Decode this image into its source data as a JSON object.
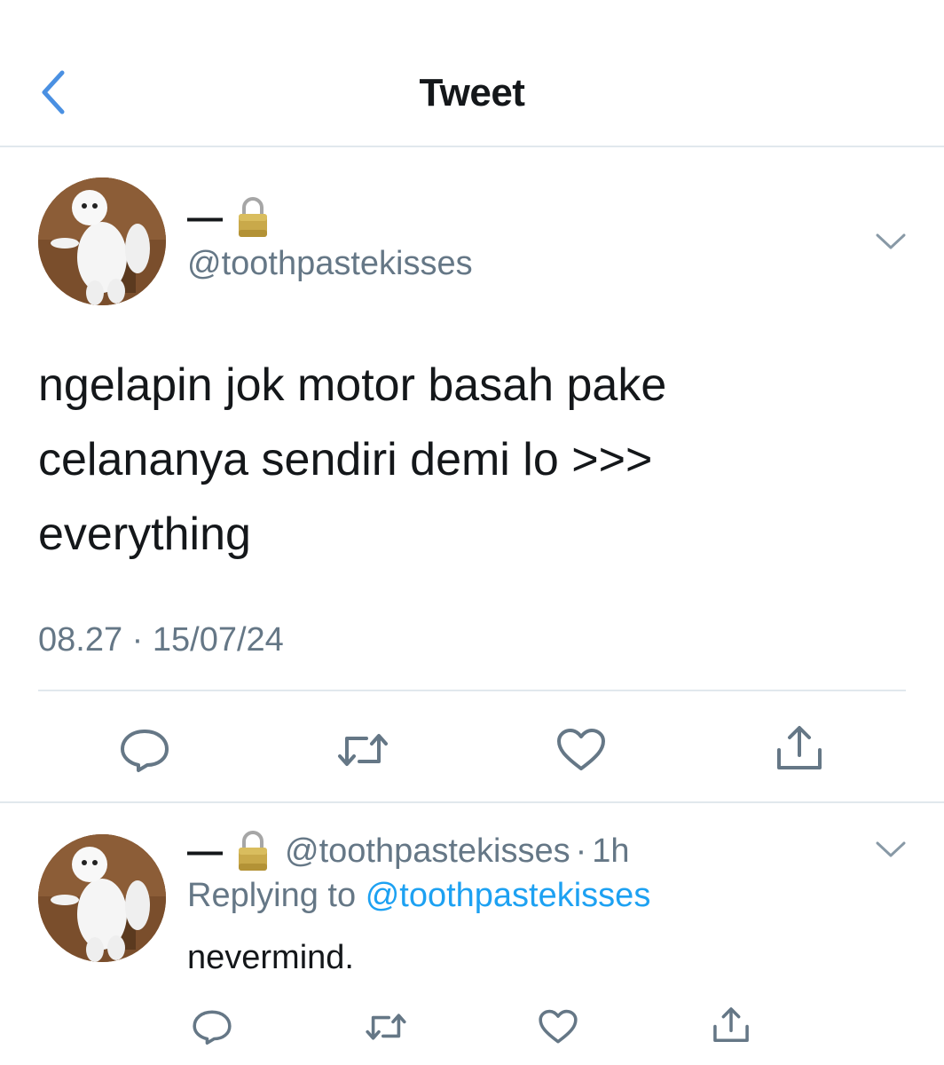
{
  "header": {
    "title": "Tweet"
  },
  "tweet": {
    "display_name": "—",
    "handle": "@toothpastekisses",
    "text_lines": [
      "ngelapin jok motor basah pake",
      "celananya sendiri demi lo >>>",
      "everything"
    ],
    "timestamp": "08.27 · 15/07/24"
  },
  "reply": {
    "display_name": "—",
    "handle": "@toothpastekisses",
    "dot": "·",
    "time": "1h",
    "replying_prefix": "Replying to",
    "replying_handle": "@toothpastekisses",
    "text": "nevermind."
  },
  "icons": {
    "back": "chevron-left-icon",
    "lock": "lock-icon",
    "caret": "chevron-down-icon",
    "reply": "reply-icon",
    "retweet": "retweet-icon",
    "like": "heart-icon",
    "share": "share-icon"
  },
  "colors": {
    "accent": "#1da1f2",
    "muted": "#657786",
    "icon": "#657786",
    "divider": "#e1e8ed"
  }
}
